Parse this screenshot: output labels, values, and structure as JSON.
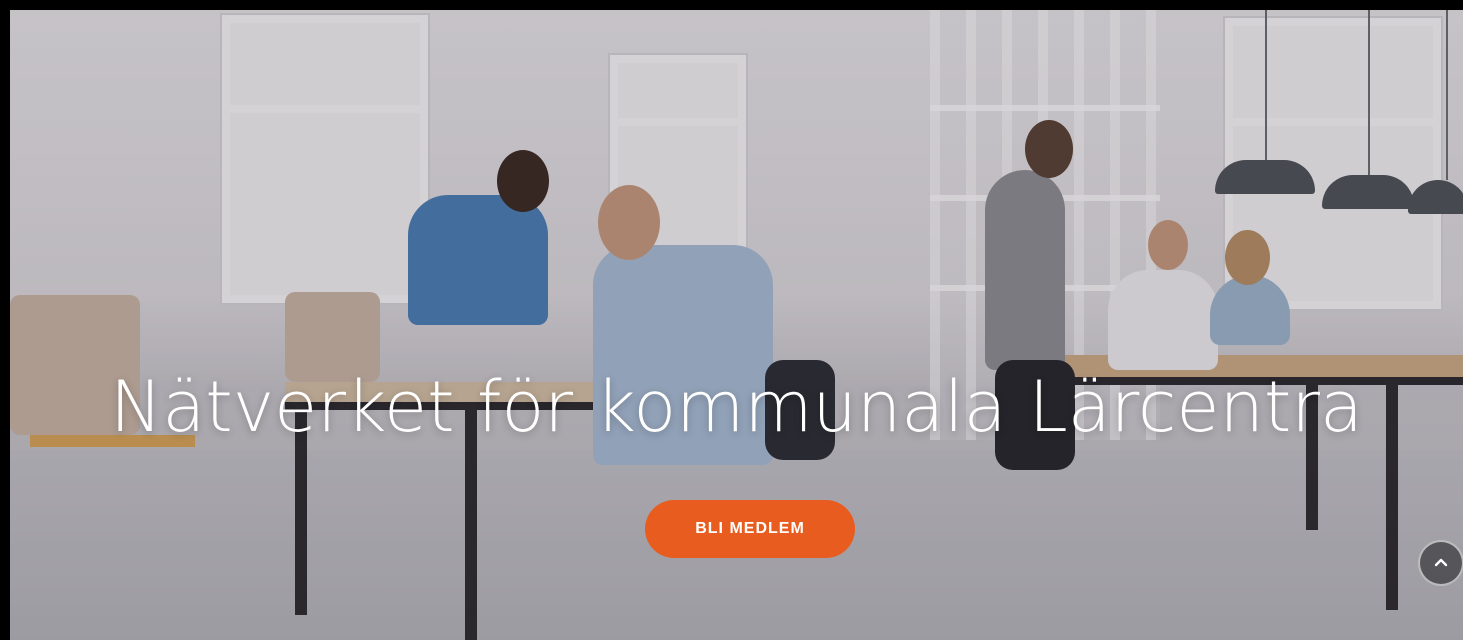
{
  "hero": {
    "headline": "Nätverket för kommunala Lärcentra",
    "background_description_icon": "office-photo",
    "overlay_color": "#2a1e2e"
  },
  "cta": {
    "label": "BLI MEDLEM",
    "color": "#e85d1f"
  },
  "scroll_top": {
    "icon": "chevron-up-icon"
  }
}
